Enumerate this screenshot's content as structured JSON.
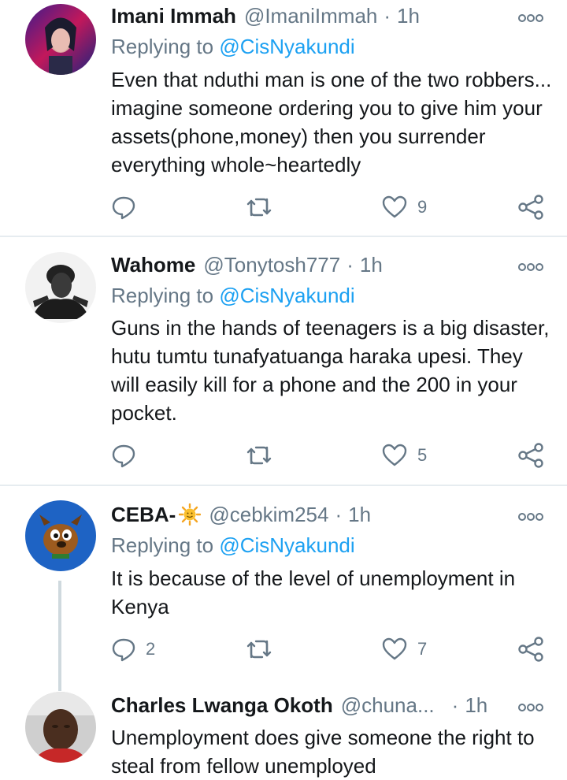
{
  "tweets": [
    {
      "name": "Imani Immah",
      "handle": "@ImaniImmah",
      "separator": "·",
      "time": "1h",
      "replying_prefix": "Replying to",
      "replying_to": "@CisNyakundi",
      "body": "Even that nduthi man is one of the two robbers... imagine someone ordering you to give him your assets(phone,money) then you surrender everything whole~heartedly",
      "reply_count": "",
      "retweet_count": "",
      "like_count": "9",
      "avatar_color": "#7b1fa2"
    },
    {
      "name": "Wahome",
      "handle": "@Tonytosh777",
      "separator": "·",
      "time": "1h",
      "replying_prefix": "Replying to",
      "replying_to": "@CisNyakundi",
      "body": "Guns in the hands of teenagers is a big disaster, hutu tumtu tunafyatuanga haraka upesi. They will easily kill for a phone and the 200 in your pocket.",
      "reply_count": "",
      "retweet_count": "",
      "like_count": "5",
      "avatar_color": "#e0e0e0"
    },
    {
      "name": "CEBA-",
      "handle": "@cebkim254",
      "separator": "·",
      "time": "1h",
      "replying_prefix": "Replying to",
      "replying_to": "@CisNyakundi",
      "body": "It is because of the level of unemployment in Kenya",
      "reply_count": "2",
      "retweet_count": "",
      "like_count": "7",
      "avatar_color": "#1565c0"
    },
    {
      "name": "Charles Lwanga Okoth",
      "handle": "@chuna...",
      "separator": "·",
      "time": "1h",
      "body": "Unemployment does give someone the right to steal from fellow unemployed",
      "avatar_color": "#5d4037"
    }
  ],
  "colors": {
    "text": "#14171a",
    "secondary": "#657786",
    "link": "#1da1f2",
    "divider": "#e6ecf0"
  },
  "icons": [
    "more-icon",
    "reply-icon",
    "retweet-icon",
    "like-icon",
    "share-icon",
    "sun-emoji-icon"
  ]
}
